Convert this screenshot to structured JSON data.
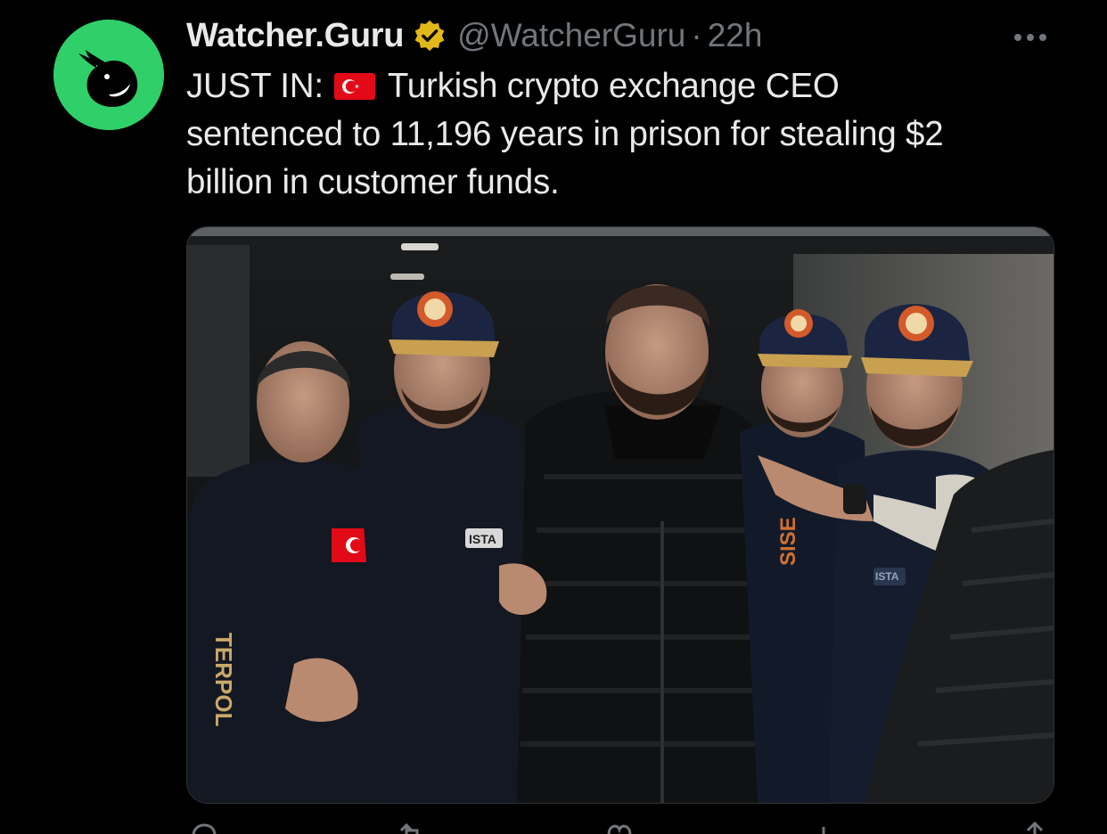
{
  "author": {
    "display_name": "Watcher.Guru",
    "handle": "@WatcherGuru",
    "separator": "·",
    "time": "22h",
    "verified": true,
    "avatar_icon": "whale-logo-icon"
  },
  "tweet": {
    "lines": [
      {
        "prefix": "JUST IN:",
        "flag": "turkey-flag-icon",
        "rest": "Turkish crypto exchange CEO"
      },
      {
        "text": "sentenced to 11,196 years in prison for stealing $2"
      },
      {
        "text": "billion in customer funds."
      }
    ]
  },
  "media": {
    "jacket_texts": [
      "ISTA",
      "ISTA",
      "TERPOL",
      "SISE"
    ]
  },
  "actions": [
    "reply-icon",
    "retweet-icon",
    "like-icon",
    "views-icon",
    "share-icon"
  ],
  "colors": {
    "background": "#000000",
    "text_primary": "#e7e9ea",
    "text_secondary": "#71767b",
    "verified_gold": "#e2b719",
    "avatar_green": "#2fcf6a",
    "turkey_red": "#e30a17"
  }
}
